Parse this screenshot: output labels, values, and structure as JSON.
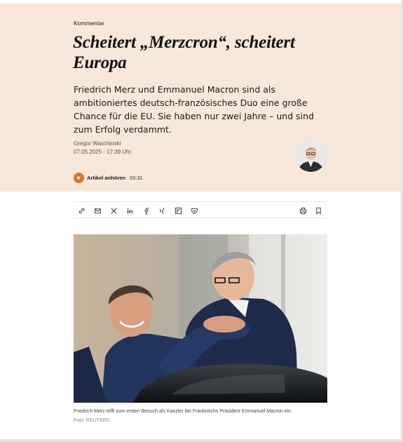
{
  "article": {
    "kicker": "Kommentar",
    "headline_line1": "Scheitert „Merzcron“, scheitert",
    "headline_line2": "Europa",
    "teaser": "Friedrich Merz und Emmanuel Macron sind als ambitioniertes deutsch-französisches Duo eine große Chance für die EU. Sie haben nur zwei Jahre – und sind zum Erfolg verdammt.",
    "author": "Gregor Waschinski",
    "date": "07.05.2025 - 17:39 Uhr"
  },
  "audio": {
    "label": "Artikel anhören",
    "duration": "03:31"
  },
  "toolbar": {
    "left_icons": [
      "link-icon",
      "mail-icon",
      "x-icon",
      "linkedin-icon",
      "facebook-icon",
      "xing-icon",
      "flipboard-icon",
      "pocket-icon"
    ],
    "right_icons": [
      "print-icon",
      "bookmark-icon"
    ]
  },
  "image": {
    "caption": "Friedrich Merz trifft zum ersten Besuch als Kanzler bei Frankreichs Präsident Emmanuel Macron ein.",
    "credit": "Foto: REUTERS"
  },
  "colors": {
    "hero_bg": "#f7e8da",
    "accent": "#d9742d",
    "text": "#1a1a1a"
  }
}
